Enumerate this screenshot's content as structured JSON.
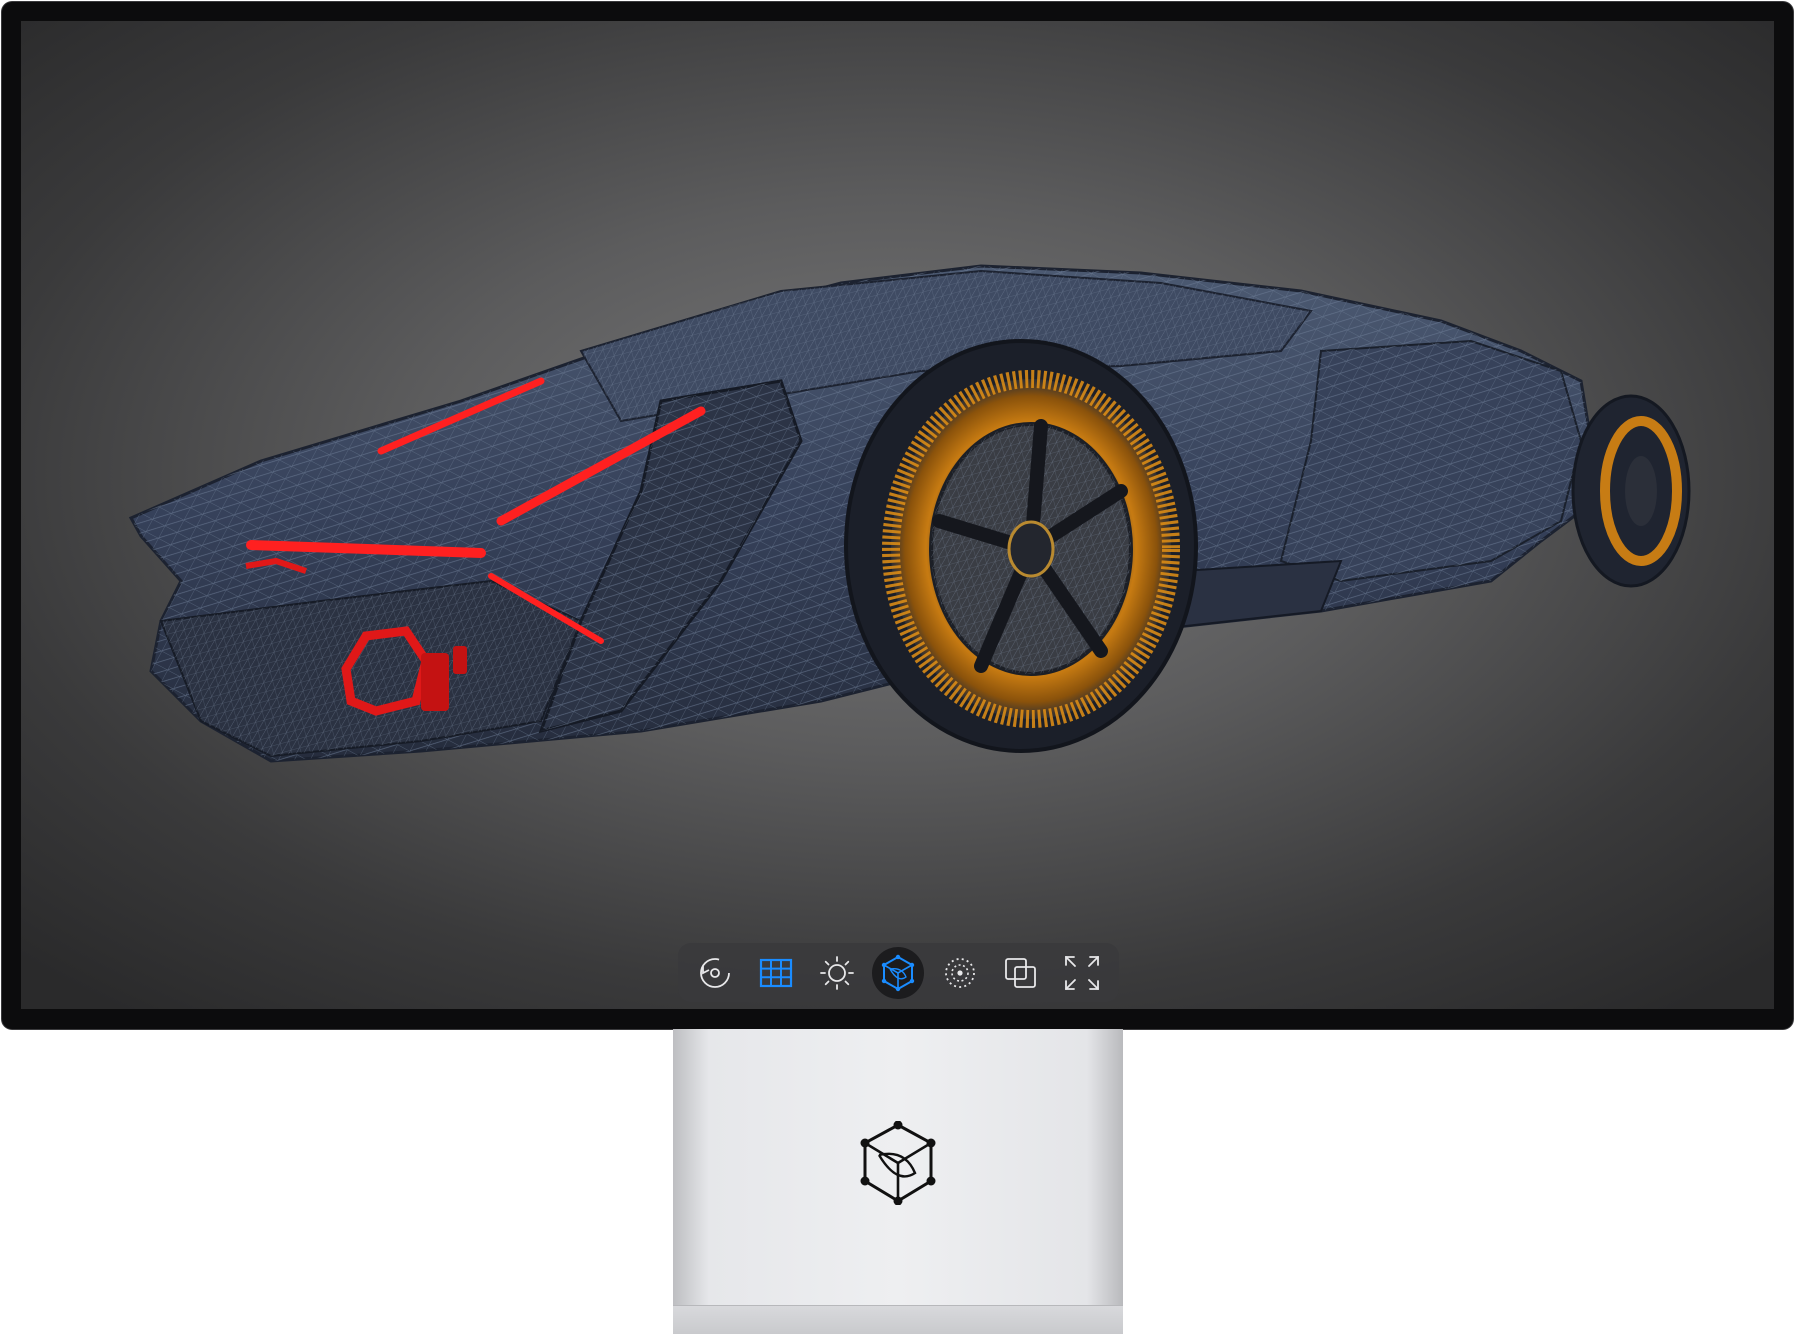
{
  "viewer": {
    "model": "car-wireframe-model",
    "accent_color": "#1a8cff",
    "highlight_color": "#ff2222",
    "wheel_color": "#e08a10"
  },
  "toolbar": {
    "buttons": [
      {
        "name": "rotate-button",
        "icon": "rotate-icon",
        "active": false
      },
      {
        "name": "grid-button",
        "icon": "grid-icon",
        "active": false
      },
      {
        "name": "lighting-button",
        "icon": "sun-icon",
        "active": false
      },
      {
        "name": "wireframe-button",
        "icon": "cube-network-icon",
        "active": true
      },
      {
        "name": "environment-button",
        "icon": "dotted-circle-icon",
        "active": false
      },
      {
        "name": "layers-button",
        "icon": "layers-icon",
        "active": false
      },
      {
        "name": "fullscreen-button",
        "icon": "fullscreen-icon",
        "active": false
      }
    ]
  },
  "stand": {
    "logo_icon": "cube-network-logo-icon"
  }
}
